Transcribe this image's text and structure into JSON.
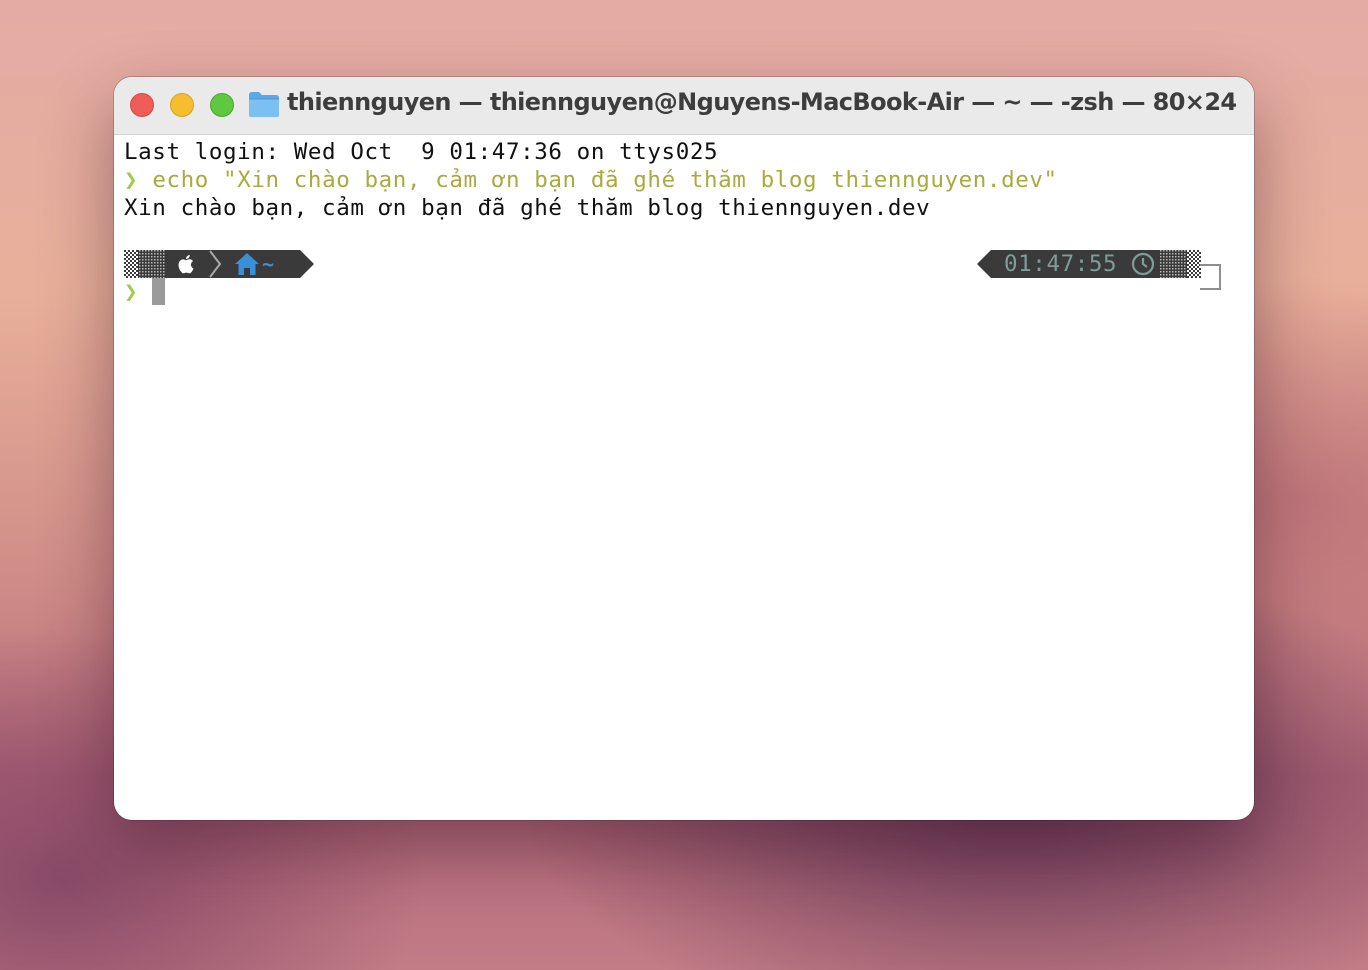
{
  "window": {
    "title": "thiennguyen — thiennguyen@Nguyens-MacBook-Air — ~ — -zsh — 80×24",
    "title_icon": "folder-icon"
  },
  "terminal": {
    "last_login": "Last login: Wed Oct  9 01:47:36 on ttys025",
    "prompt_symbol": "❯",
    "command": "echo \"Xin chào bạn, cảm ơn bạn đã ghé thăm blog thiennguyen.dev\"",
    "output": "Xin chào bạn, cảm ơn bạn đã ghé thăm blog thiennguyen.dev",
    "prompt_segments": {
      "os_icon": "apple-icon",
      "home_icon": "home-icon",
      "directory": "~"
    },
    "right_prompt": {
      "time": "01:47:55",
      "clock_icon": "clock-icon"
    }
  },
  "colors": {
    "prompt_green": "#9ccd52",
    "command_olive": "#a9ab3f",
    "segment_bg": "#3a3a3a",
    "home_blue": "#3a8fd9",
    "time_teal": "#7e9c98",
    "close": "#ee5e56",
    "minimize": "#f5bd2f",
    "maximize": "#5fc840"
  }
}
